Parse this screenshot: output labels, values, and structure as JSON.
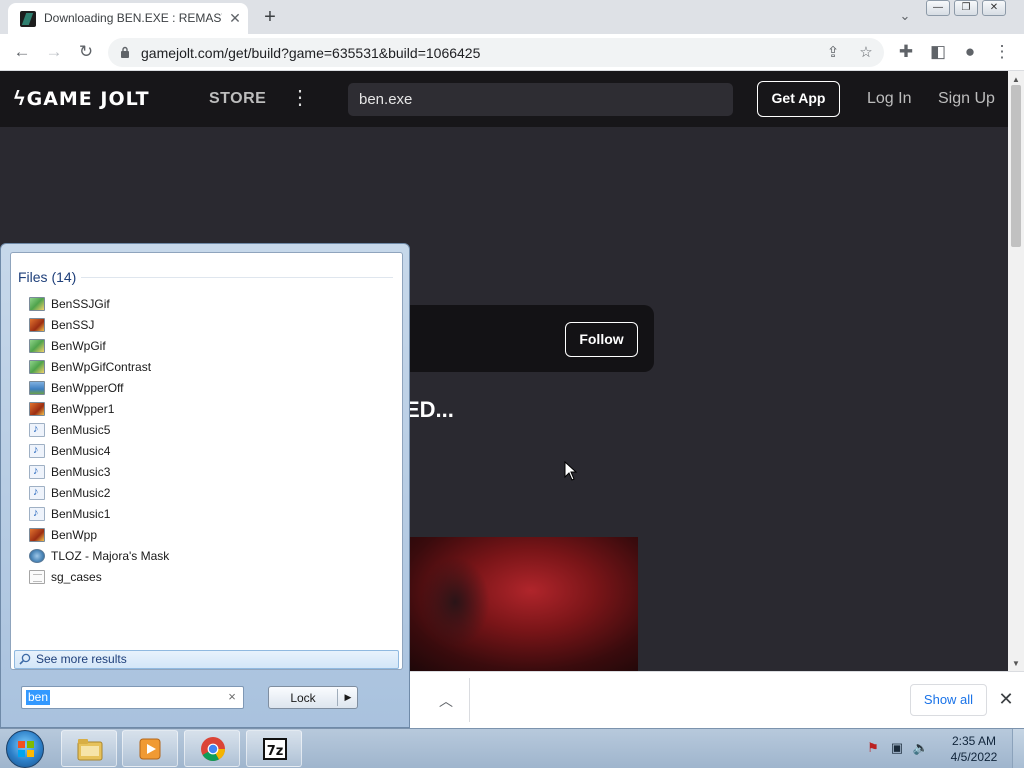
{
  "browser": {
    "tab_title": "Downloading BEN.EXE : REMAST",
    "url": "gamejolt.com/get/build?game=635531&build=1066425",
    "window_controls": {
      "minimize": "—",
      "restore": "❐",
      "close": "✕"
    }
  },
  "site": {
    "logo_text": "GAME JOLT",
    "store_label": "STORE",
    "search_value": "ben.exe",
    "get_app_label": "Get App",
    "login_label": "Log In",
    "signup_label": "Sign Up",
    "follow_label": "Follow",
    "heading_fragment": "ED..."
  },
  "download_bar": {
    "show_all_label": "Show all"
  },
  "start_menu": {
    "files_header": "Files (14)",
    "items": [
      {
        "name": "BenSSJGif",
        "icon": "gif-image-icon"
      },
      {
        "name": "BenSSJ",
        "icon": "image-icon"
      },
      {
        "name": "BenWpGif",
        "icon": "gif-image-icon"
      },
      {
        "name": "BenWpGifContrast",
        "icon": "gif-image-icon"
      },
      {
        "name": "BenWpperOff",
        "icon": "picture-icon"
      },
      {
        "name": "BenWpper1",
        "icon": "image-icon"
      },
      {
        "name": "BenMusic5",
        "icon": "music-file-icon"
      },
      {
        "name": "BenMusic4",
        "icon": "music-file-icon"
      },
      {
        "name": "BenMusic3",
        "icon": "music-file-icon"
      },
      {
        "name": "BenMusic2",
        "icon": "music-file-icon"
      },
      {
        "name": "BenMusic1",
        "icon": "music-file-icon"
      },
      {
        "name": "BenWpp",
        "icon": "image-icon"
      },
      {
        "name": "TLOZ - Majora's Mask",
        "icon": "application-icon"
      },
      {
        "name": "sg_cases",
        "icon": "text-file-icon"
      }
    ],
    "see_more_label": "See more results",
    "search_value": "ben",
    "lock_label": "Lock"
  },
  "taskbar": {
    "time": "2:35 AM",
    "date": "4/5/2022",
    "apps": [
      "file-explorer-icon",
      "media-player-icon",
      "chrome-icon",
      "7zip-icon"
    ]
  }
}
